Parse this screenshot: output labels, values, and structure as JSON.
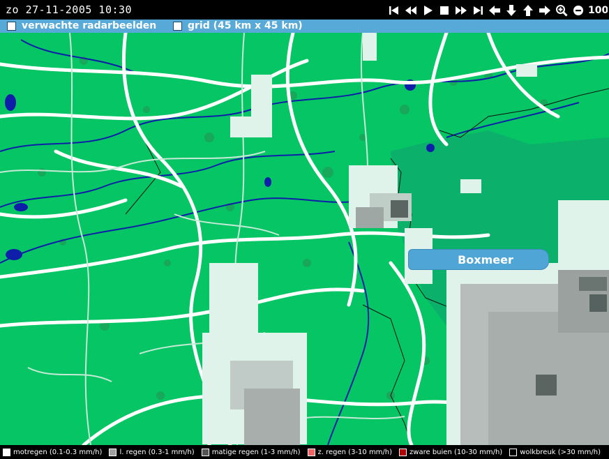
{
  "header": {
    "datetime": "zo 27-11-2005 10:30",
    "zoom_level": "100",
    "controls": [
      "first-frame",
      "step-back",
      "play",
      "stop",
      "step-forward",
      "last-frame",
      "pan-left",
      "pan-down",
      "pan-up",
      "pan-right",
      "zoom-in",
      "zoom-out"
    ]
  },
  "options": {
    "forecast_label": "verwachte radarbeelden",
    "grid_label": "grid (45 km x 45 km)"
  },
  "map": {
    "place_label": "Boxmeer",
    "colors": {
      "land": "#05c565",
      "forest": "#16a65c",
      "roads": "#ffffff",
      "rivers": "#0f1ea8",
      "rain_light": "#e0f4ec",
      "rain_light2": "#a9aeab",
      "rain_moderate": "#5d6865"
    }
  },
  "legend": [
    {
      "label": "motregen (0.1-0.3 mm/h)",
      "color": "#ffffff"
    },
    {
      "label": "l. regen (0.3-1 mm/h)",
      "color": "#a0a0a0"
    },
    {
      "label": "matige regen (1-3 mm/h)",
      "color": "#555555"
    },
    {
      "label": "z. regen (3-10 mm/h)",
      "color": "#f06464"
    },
    {
      "label": "zware buien (10-30 mm/h)",
      "color": "#b00000"
    },
    {
      "label": "wolkbreuk (>30 mm/h)",
      "color": "#000000"
    }
  ]
}
